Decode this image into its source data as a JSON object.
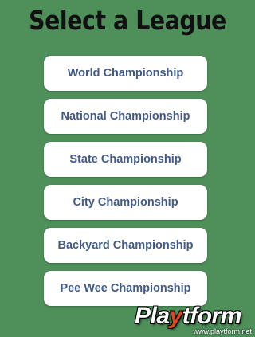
{
  "header": {
    "title": "Select a League"
  },
  "leagues": [
    {
      "label": "World Championship"
    },
    {
      "label": "National Championship"
    },
    {
      "label": "State Championship"
    },
    {
      "label": "City Championship"
    },
    {
      "label": "Backyard Championship"
    },
    {
      "label": "Pee Wee Championship"
    }
  ],
  "watermark": {
    "logo_a": "Pla",
    "logo_b": "y",
    "logo_c": "tform",
    "url": "www.playtform.net"
  },
  "colors": {
    "background": "#4e8f5a",
    "button_text": "#425a86",
    "button_bg": "#ffffff",
    "logo_accent": "#e0461b"
  }
}
